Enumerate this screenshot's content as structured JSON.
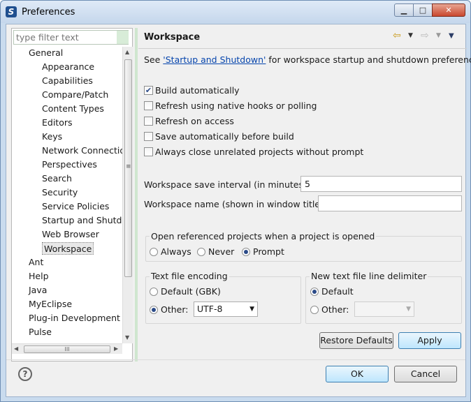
{
  "window": {
    "title": "Preferences",
    "controls": {
      "minimize": "▁",
      "maximize": "□",
      "close": "✕"
    }
  },
  "sidebar": {
    "filter_placeholder": "type filter text",
    "items": [
      {
        "label": "General",
        "level": 0
      },
      {
        "label": "Appearance",
        "level": 1
      },
      {
        "label": "Capabilities",
        "level": 1
      },
      {
        "label": "Compare/Patch",
        "level": 1
      },
      {
        "label": "Content Types",
        "level": 1
      },
      {
        "label": "Editors",
        "level": 1
      },
      {
        "label": "Keys",
        "level": 1
      },
      {
        "label": "Network Connectio",
        "level": 1
      },
      {
        "label": "Perspectives",
        "level": 1
      },
      {
        "label": "Search",
        "level": 1
      },
      {
        "label": "Security",
        "level": 1
      },
      {
        "label": "Service Policies",
        "level": 1
      },
      {
        "label": "Startup and Shutd",
        "level": 1
      },
      {
        "label": "Web Browser",
        "level": 1
      },
      {
        "label": "Workspace",
        "level": 1,
        "selected": true
      },
      {
        "label": "Ant",
        "level": 0
      },
      {
        "label": "Help",
        "level": 0
      },
      {
        "label": "Java",
        "level": 0
      },
      {
        "label": "MyEclipse",
        "level": 0
      },
      {
        "label": "Plug-in Development",
        "level": 0
      },
      {
        "label": "Pulse",
        "level": 0
      }
    ],
    "hscroll_grip": "III",
    "vscroll_grip": "≡"
  },
  "page": {
    "title": "Workspace",
    "desc_prefix": "See ",
    "desc_link": "'Startup and Shutdown'",
    "desc_suffix": " for workspace startup and shutdown preferences.",
    "checkboxes": [
      {
        "label": "Build automatically",
        "checked": true
      },
      {
        "label": "Refresh using native hooks or polling",
        "checked": false
      },
      {
        "label": "Refresh on access",
        "checked": false
      },
      {
        "label": "Save automatically before build",
        "checked": false
      },
      {
        "label": "Always close unrelated projects without prompt",
        "checked": false
      }
    ],
    "save_interval_label": "Workspace save interval (in minutes):",
    "save_interval_value": "5",
    "workspace_name_label": "Workspace name (shown in window title):",
    "workspace_name_value": "",
    "open_projects": {
      "title": "Open referenced projects when a project is opened",
      "options": [
        "Always",
        "Never",
        "Prompt"
      ],
      "selected": "Prompt"
    },
    "encoding": {
      "title": "Text file encoding",
      "default_label": "Default (GBK)",
      "other_label": "Other:",
      "selected": "Other",
      "other_value": "UTF-8"
    },
    "line_delimiter": {
      "title": "New text file line delimiter",
      "default_label": "Default",
      "other_label": "Other:",
      "selected": "Default",
      "other_value": ""
    },
    "restore_defaults_label": "Restore Defaults",
    "apply_label": "Apply"
  },
  "footer": {
    "help_label": "?",
    "ok_label": "OK",
    "cancel_label": "Cancel"
  }
}
